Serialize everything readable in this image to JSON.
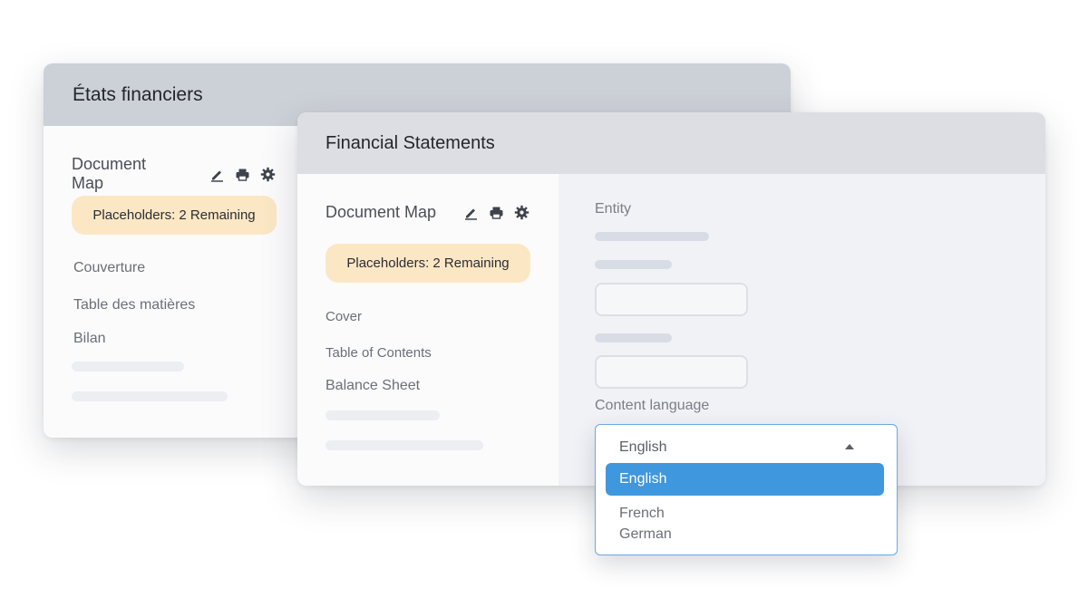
{
  "back_window": {
    "title": "États financiers",
    "sidebar": {
      "map_title": "Document Map",
      "badge": "Placeholders: 2 Remaining",
      "items": [
        "Couverture",
        "Table des matières",
        "Bilan"
      ]
    }
  },
  "front_window": {
    "title": "Financial Statements",
    "sidebar": {
      "map_title": "Document Map",
      "badge": "Placeholders: 2 Remaining",
      "items": [
        "Cover",
        "Table of Contents",
        "Balance Sheet"
      ]
    },
    "form": {
      "entity_label": "Entity",
      "content_language_label": "Content language"
    }
  },
  "language_dropdown": {
    "selected": "English",
    "options": [
      "English",
      "French",
      "German"
    ],
    "highlighted_option": "English"
  },
  "icons": {
    "edit": "pencil-icon",
    "print": "printer-icon",
    "settings": "gear-icon"
  },
  "colors": {
    "badge_bg": "#fce7c5",
    "dropdown_highlight": "#3f97de",
    "dropdown_border": "#6aa9e6"
  }
}
